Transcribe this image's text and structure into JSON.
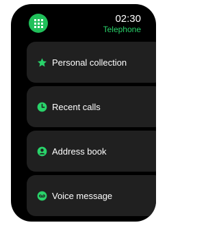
{
  "status": {
    "time": "02:30",
    "app_title": "Telephone"
  },
  "menu": {
    "items": [
      {
        "label": "Personal collection",
        "icon": "star-icon"
      },
      {
        "label": "Recent calls",
        "icon": "clock-icon"
      },
      {
        "label": "Address book",
        "icon": "contact-icon"
      },
      {
        "label": "Voice message",
        "icon": "voicemail-icon"
      }
    ]
  },
  "colors": {
    "background": "#000000",
    "accent": "#29d36a",
    "card": "#202020",
    "text": "#ffffff"
  }
}
